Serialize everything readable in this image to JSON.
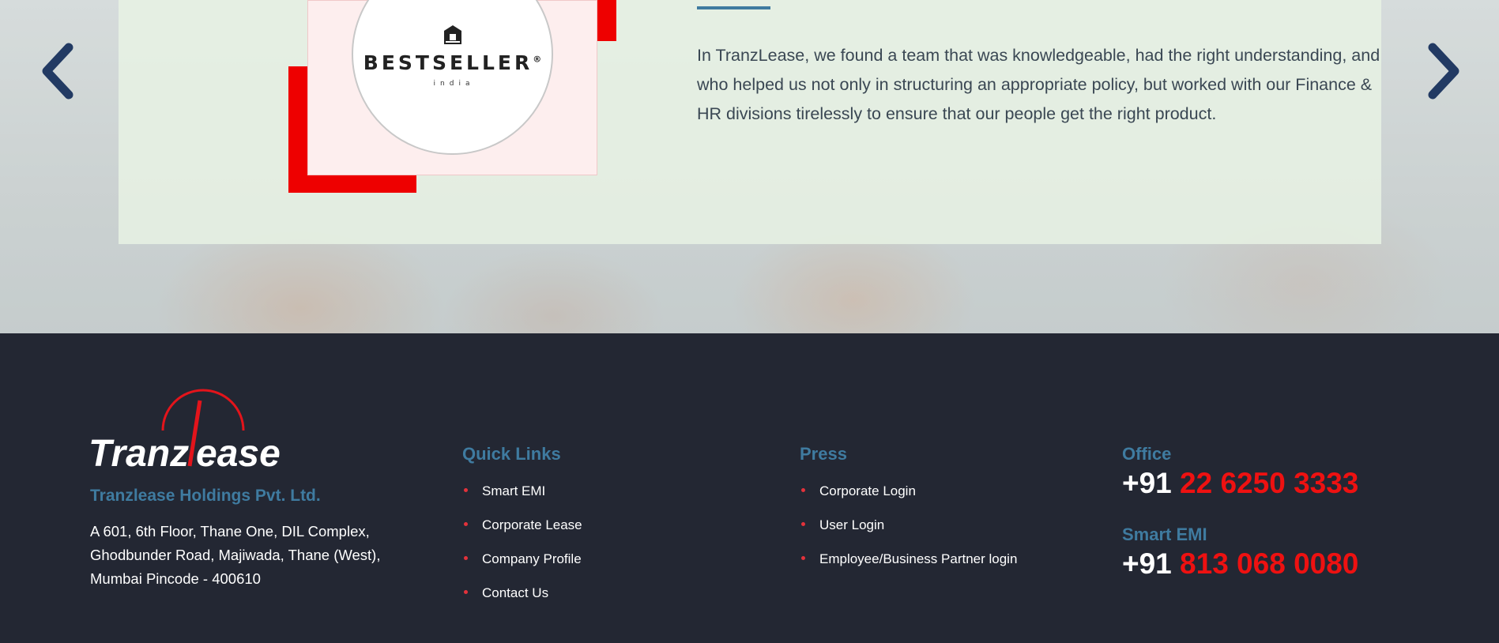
{
  "colors": {
    "accent_blue": "#3f7ba0",
    "brand_red": "#ee0000",
    "footer_bg": "#232733",
    "card_bg": "#e8f2e4",
    "arrow": "#223a63"
  },
  "slider": {
    "prev_icon": "chevron-left-icon",
    "next_icon": "chevron-right-icon"
  },
  "testimonial": {
    "client_logo": {
      "brand": "BESTSELLER",
      "mark": "®",
      "sub": "india"
    },
    "quote": "In TranzLease, we found a team that was knowledgeable, had the right understanding, and who helped us not only in structuring an appropriate policy, but worked with our Finance & HR divisions tirelessly to ensure that our people get the right product."
  },
  "footer": {
    "logo": {
      "left": "Tranz",
      "right": "ease"
    },
    "company_name": "Tranzlease Holdings Pvt. Ltd.",
    "address": [
      "A 601, 6th Floor, Thane One, DIL Complex,",
      "Ghodbunder Road, Majiwada, Thane (West),",
      "Mumbai Pincode - 400610"
    ],
    "quick_links": {
      "title": "Quick Links",
      "items": [
        "Smart EMI",
        "Corporate Lease",
        "Company Profile",
        "Contact Us"
      ]
    },
    "press": {
      "title": "Press",
      "items": [
        "Corporate Login",
        "User Login",
        "Employee/Business Partner login"
      ]
    },
    "contacts": [
      {
        "label": "Office",
        "prefix": "+91",
        "number": "22 6250 3333"
      },
      {
        "label": "Smart EMI",
        "prefix": "+91",
        "number": "813 068 0080"
      }
    ]
  }
}
